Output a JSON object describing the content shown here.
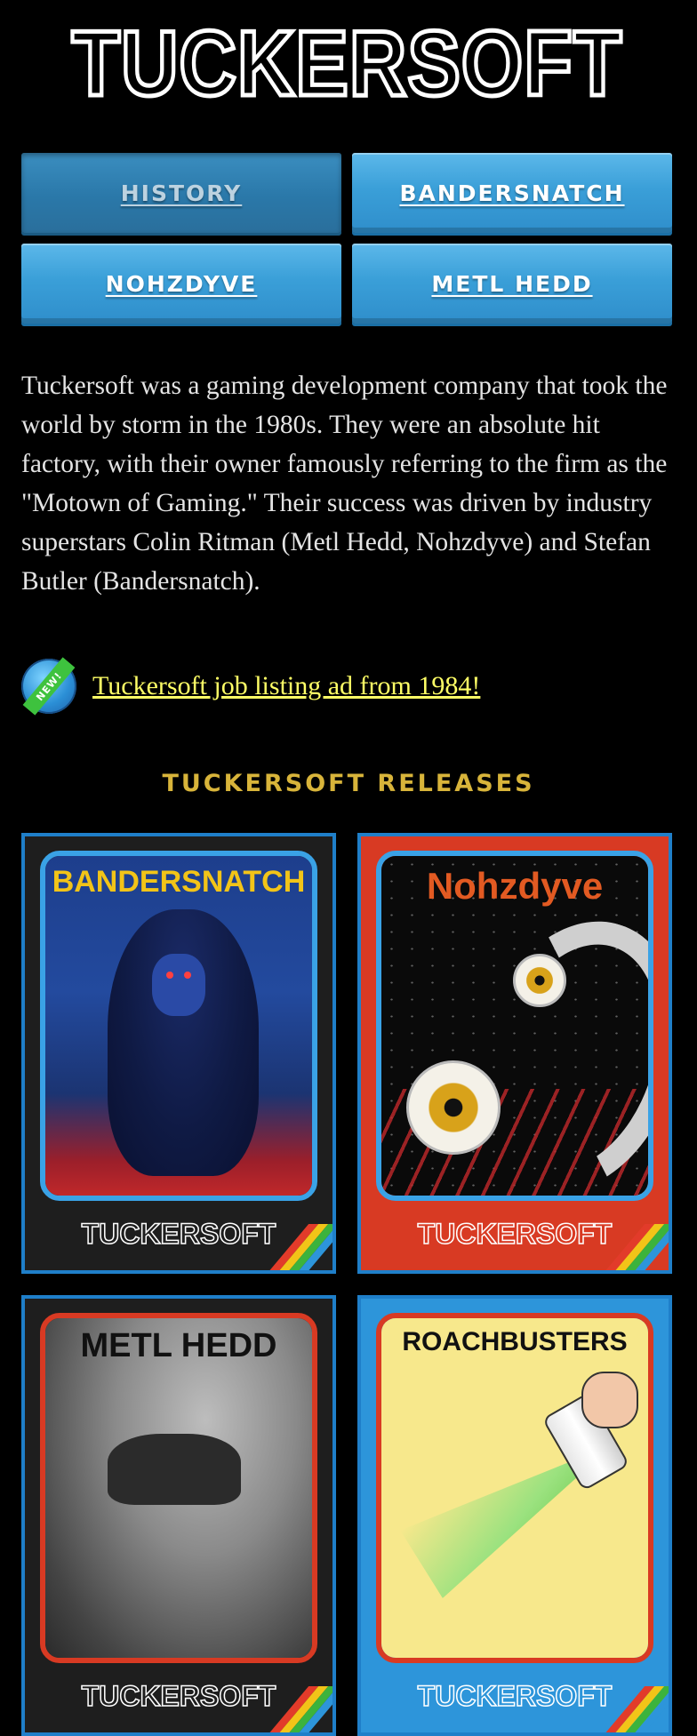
{
  "logo": {
    "text": "TUCKERSOFT"
  },
  "nav": {
    "items": [
      {
        "label": "HISTORY",
        "active": true
      },
      {
        "label": "BANDERSNATCH",
        "active": false
      },
      {
        "label": "NOHZDYVE",
        "active": false
      },
      {
        "label": "METL HEDD",
        "active": false
      }
    ]
  },
  "intro": {
    "text": "Tuckersoft was a gaming development company that took the world by storm in the 1980s. They were an absolute hit factory, with their owner famously referring to the firm as the \"Motown of Gaming.\" Their success was driven by industry superstars Colin Ritman (Metl Hedd, Nohzdyve) and Stefan Butler (Bandersnatch)."
  },
  "job": {
    "badge_text": "NEW!",
    "link_text": "Tuckersoft job listing ad from 1984!"
  },
  "releases": {
    "title": "TUCKERSOFT RELEASES",
    "cards": [
      {
        "title": "BANDERSNATCH",
        "brand": "TUCKERSOFT"
      },
      {
        "title": "Nohzdyve",
        "brand": "TUCKERSOFT"
      },
      {
        "title": "METL HEDD",
        "brand": "TUCKERSOFT"
      },
      {
        "title": "ROACHBUSTERS",
        "brand": "TUCKERSOFT"
      }
    ]
  },
  "colors": {
    "background": "#000000",
    "nav_blue": "#3a9fd8",
    "link_yellow": "#ffff66",
    "releases_gold": "#d8b43a",
    "card_red": "#d83a23",
    "card_blue": "#2d95da"
  }
}
